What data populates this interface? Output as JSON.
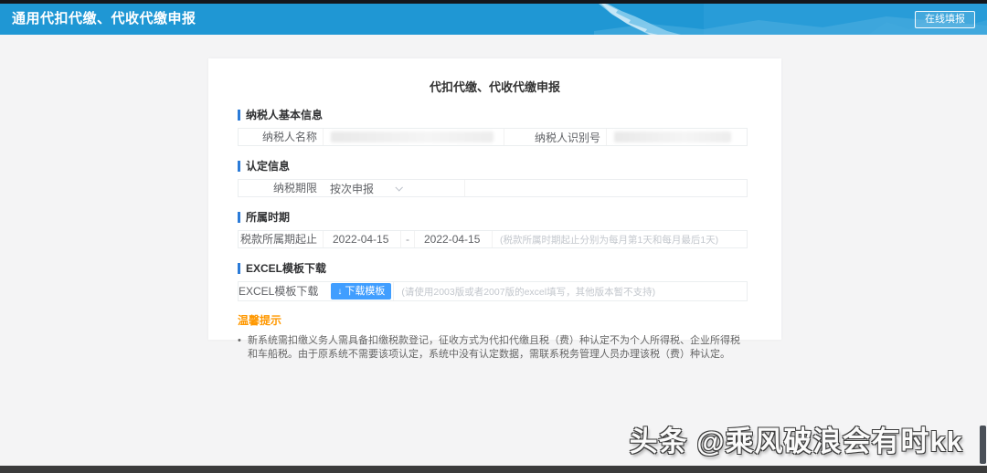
{
  "header": {
    "title": "通用代扣代缴、代收代缴申报",
    "online_fill_button": "在线填报"
  },
  "form": {
    "title": "代扣代缴、代收代缴申报",
    "basic": {
      "title": "纳税人基本信息",
      "name_label": "纳税人名称",
      "name_value": "",
      "id_label": "纳税人识别号",
      "id_value": ""
    },
    "recognition": {
      "title": "认定信息",
      "period_label": "纳税期限",
      "period_value": "按次申报"
    },
    "period": {
      "title": "所属时期",
      "range_label": "税款所属期起止",
      "start": "2022-04-15",
      "separator": "-",
      "end": "2022-04-15",
      "hint": "(税款所属时期起止分别为每月第1天和每月最后1天)"
    },
    "excel": {
      "title": "EXCEL模板下载",
      "label": "EXCEL模板下载",
      "download_icon": "↓",
      "button": "下载模板",
      "hint": "(请使用2003版或者2007版的excel填写，其他版本暂不支持)"
    },
    "tips": {
      "title": "温馨提示",
      "items": [
        "新系统需扣缴义务人需具备扣缴税款登记，征收方式为代扣代缴且税（费）种认定不为个人所得税、企业所得税和车船税。由于原系统不需要该项认定，系统中没有认定数据，需联系税务管理人员办理该税（费）种认定。"
      ]
    }
  },
  "watermark": "头条 @乘风破浪会有时kk",
  "colors": {
    "header_blue": "#1f97d4",
    "section_bar_blue": "#2b7bd8",
    "button_blue": "#409eff",
    "tip_orange": "#ff9800"
  }
}
